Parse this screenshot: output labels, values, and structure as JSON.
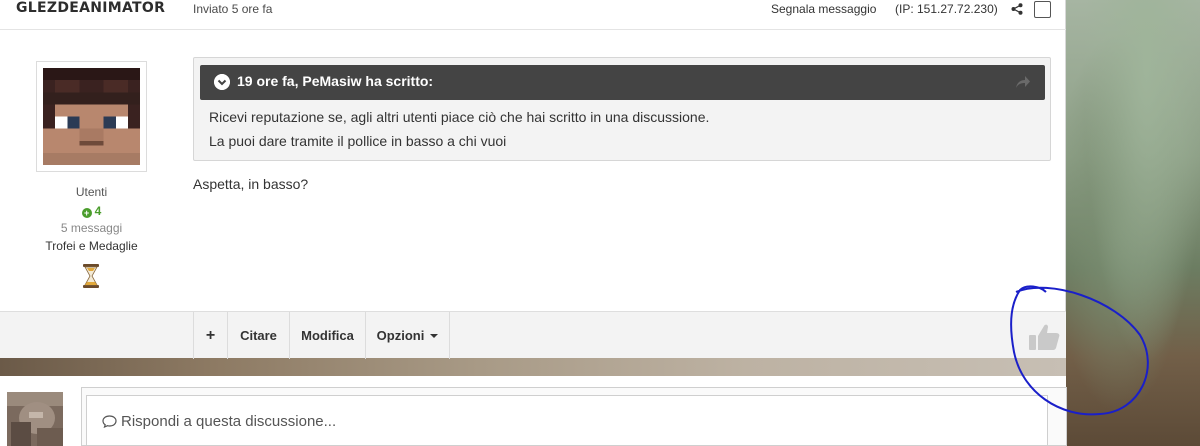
{
  "post": {
    "author": "GLEZDEANIMATOR",
    "time": "Inviato 5 ore fa",
    "report_label": "Segnala messaggio",
    "ip": "(IP: 151.27.72.230)"
  },
  "author_panel": {
    "group": "Utenti",
    "reputation": "4",
    "post_count": "5 messaggi",
    "trophies_label": "Trofei e Medaglie"
  },
  "quote": {
    "header": "19 ore fa, PeMasiw ha scritto:",
    "line1": "Ricevi reputazione se, agli altri utenti piace ciò che hai scritto in una discussione.",
    "line2": "La puoi dare tramite il pollice in basso a chi vuoi"
  },
  "reply_text": "Aspetta, in basso?",
  "footer_tools": {
    "multiquote": "+",
    "quote": "Citare",
    "edit": "Modifica",
    "options": "Opzioni"
  },
  "reply_box": {
    "placeholder": "Rispondi a questa discussione..."
  },
  "icons": {
    "share": "share-icon",
    "chevron": "chevron-down-circle-icon",
    "jump": "jump-to-post-icon",
    "thumb": "thumbs-up-icon",
    "hourglass": "hourglass-icon",
    "bubble": "speech-bubble-icon"
  },
  "colors": {
    "quote_header_bg": "#444444",
    "reputation_green": "#4a9d2c",
    "annotation_circle": "#1a1fc9"
  }
}
